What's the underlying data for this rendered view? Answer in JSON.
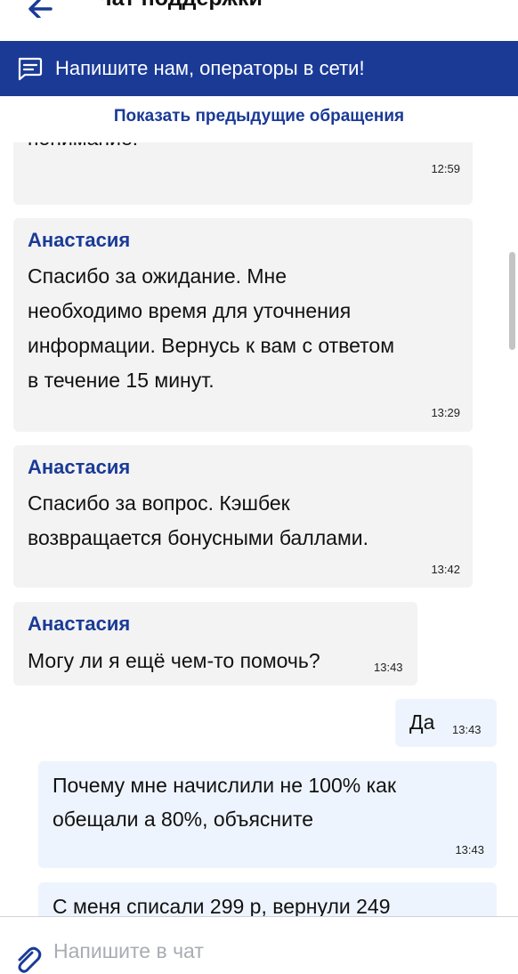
{
  "header": {
    "title": "Чат поддержки"
  },
  "banner": {
    "text": "Напишите нам, операторы в сети!"
  },
  "history_link": "Показать предыдущие обращения",
  "messages": [
    {
      "sender": "",
      "lines": [
        "понимание!"
      ],
      "time": "12:59"
    },
    {
      "sender": "Анастасия",
      "lines": [
        "Спасибо за ожидание. Мне",
        "необходимо время для уточнения",
        "информации. Вернусь к вам с ответом",
        "в течение 15 минут."
      ],
      "time": "13:29"
    },
    {
      "sender": "Анастасия",
      "lines": [
        "Спасибо за вопрос. Кэшбек",
        "возвращается бонусными баллами."
      ],
      "time": "13:42"
    },
    {
      "sender": "Анастасия",
      "lines": [
        "Могу ли я ещё чем-то помочь?"
      ],
      "time": "13:43"
    },
    {
      "sender": "",
      "lines": [
        "Да"
      ],
      "time": "13:43"
    },
    {
      "sender": "",
      "lines": [
        "Почему мне начислили не 100% как",
        "обещали а 80%, объясните"
      ],
      "time": "13:43"
    },
    {
      "sender": "",
      "lines": [
        "С меня списали 299 р, вернули 249"
      ],
      "time": ""
    }
  ],
  "composer": {
    "placeholder": "Напишите в чат",
    "value": ""
  },
  "icons": {
    "back": "arrow-left-icon",
    "banner": "chat-bubble-icon",
    "attach": "paperclip-icon"
  },
  "colors": {
    "brand": "#1a3a96",
    "operator_bubble": "#f3f3f4",
    "user_bubble": "#eef4fd"
  }
}
